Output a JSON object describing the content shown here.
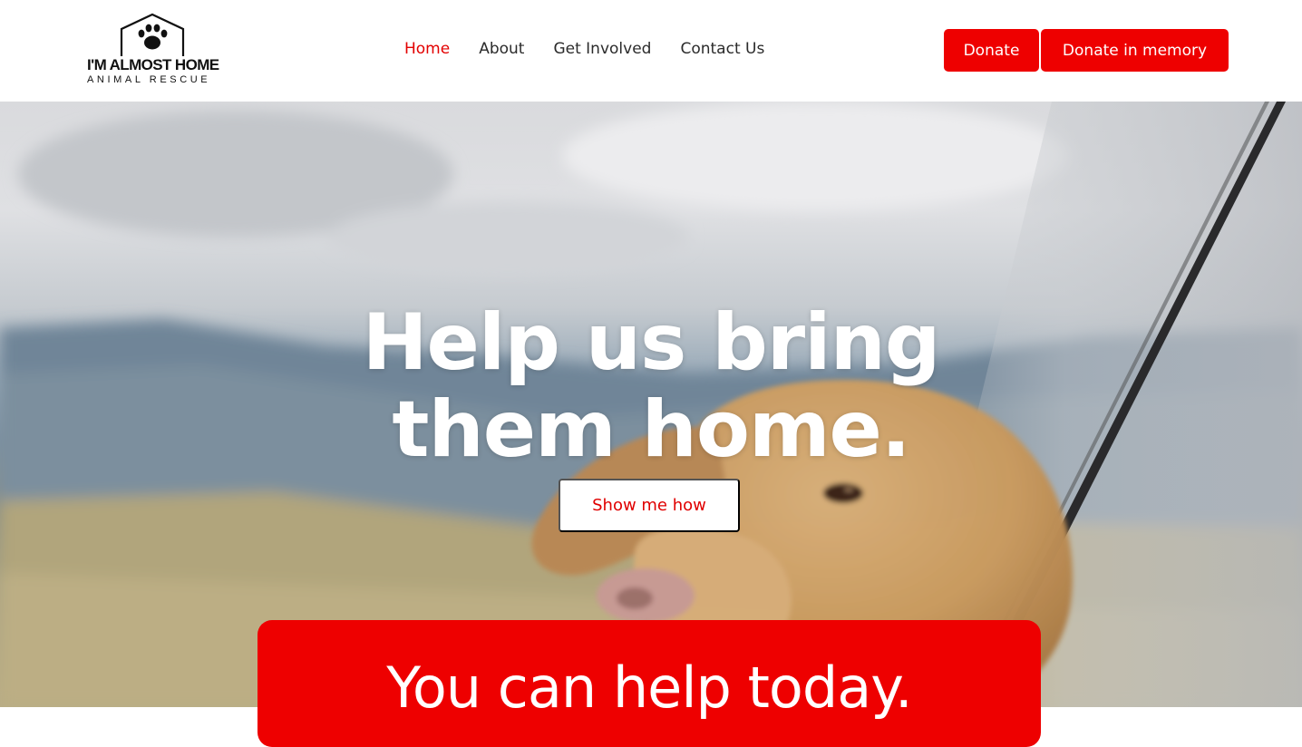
{
  "brand": {
    "name": "I'M ALMOST HOME",
    "tagline": "ANIMAL RESCUE",
    "logo_icon": "paw-house-icon"
  },
  "nav": {
    "items": [
      {
        "label": "Home",
        "active": true
      },
      {
        "label": "About",
        "active": false
      },
      {
        "label": "Get Involved",
        "active": false
      },
      {
        "label": "Contact Us",
        "active": false
      }
    ]
  },
  "actions": {
    "donate_label": "Donate",
    "donate_memory_label": "Donate in memory"
  },
  "hero": {
    "title_line1": "Help us bring",
    "title_line2": "them home.",
    "cta_label": "Show me how",
    "image_subject": "dog-in-car-window"
  },
  "help_section": {
    "title": "You can help today."
  },
  "colors": {
    "accent": "#ee0000",
    "nav_active": "#e30000",
    "nav_text": "#2b2b2b",
    "hero_text": "#ffffff"
  }
}
